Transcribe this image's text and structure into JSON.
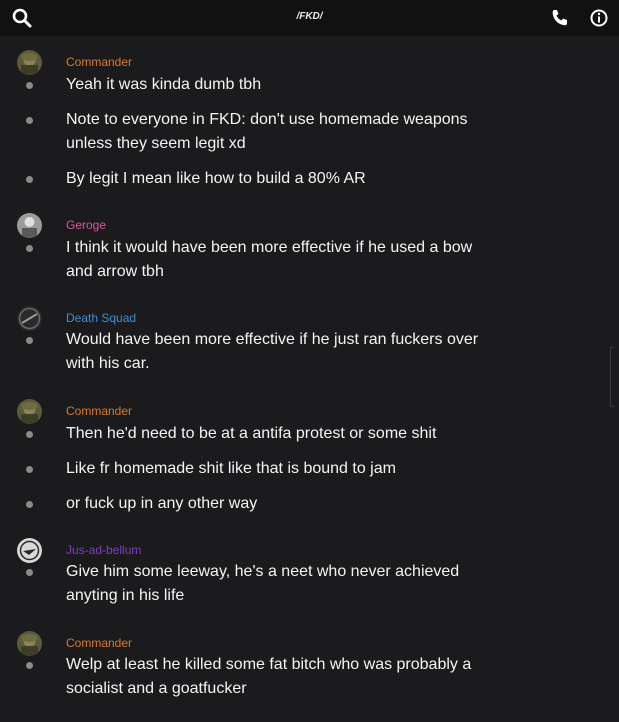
{
  "header": {
    "title": "/FKD/",
    "icons": [
      "search-icon",
      "phone-icon",
      "info-icon"
    ]
  },
  "messages": [
    {
      "user": "Commander",
      "user_color": "#d97a2b",
      "avatar": "green-helmet-avatar",
      "lines": [
        "Yeah it was kinda dumb tbh",
        "Note to everyone in FKD: don't use homemade weapons unless they seem legit xd",
        "By legit I mean like how to build a 80% AR"
      ]
    },
    {
      "user": "Geroge",
      "user_color": "#d8569f",
      "avatar": "gray-portrait-avatar",
      "lines": [
        "I think it would have been more effective if he used a bow and arrow tbh"
      ]
    },
    {
      "user": "Death Squad",
      "user_color": "#3e8ed0",
      "avatar": "dark-badge-avatar",
      "lines": [
        "Would have been more effective if he just ran fuckers over with his car."
      ]
    },
    {
      "user": "Commander",
      "user_color": "#d97a2b",
      "avatar": "green-helmet-avatar",
      "lines": [
        "Then he'd need to be at a antifa protest or some shit",
        "Like fr homemade shit like that is bound to jam",
        "or fuck up in any other way"
      ]
    },
    {
      "user": "Jus-ad-bellum",
      "user_color": "#7a3fc0",
      "avatar": "white-emblem-avatar",
      "lines": [
        "Give him some leeway, he's a neet who never achieved anyting in his life"
      ]
    },
    {
      "user": "Commander",
      "user_color": "#d97a2b",
      "avatar": "green-helmet-avatar",
      "lines": [
        "Welp at least he killed some fat bitch who was probably a socialist and a goatfucker"
      ]
    }
  ]
}
